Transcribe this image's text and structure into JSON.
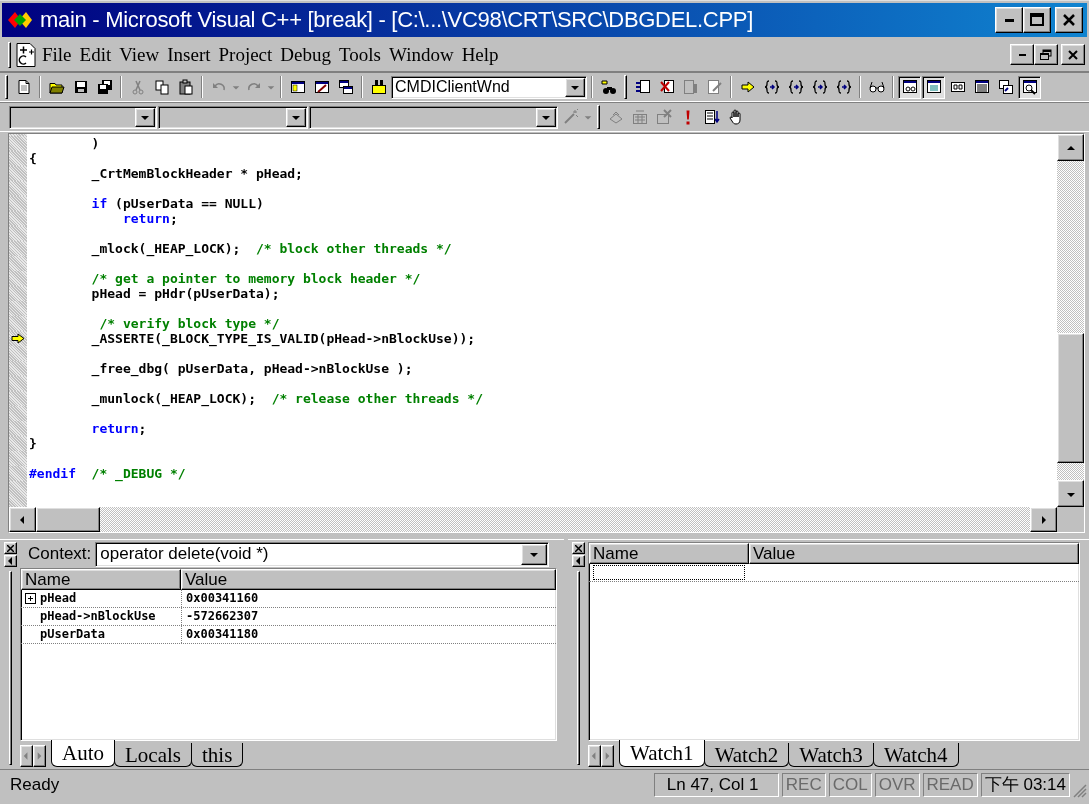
{
  "window": {
    "title": "main - Microsoft Visual C++ [break] - [C:\\...\\VC98\\CRT\\SRC\\DBGDEL.CPP]"
  },
  "menu": [
    {
      "label": "File"
    },
    {
      "label": "Edit"
    },
    {
      "label": "View"
    },
    {
      "label": "Insert"
    },
    {
      "label": "Project"
    },
    {
      "label": "Debug"
    },
    {
      "label": "Tools"
    },
    {
      "label": "Window"
    },
    {
      "label": "Help"
    }
  ],
  "toolbar": {
    "combo_value": "CMDIClientWnd",
    "debug_window_buttons": [
      {
        "pressed": true
      },
      {
        "pressed": true
      },
      {
        "pressed": false
      },
      {
        "pressed": false
      },
      {
        "pressed": false
      },
      {
        "pressed": true
      }
    ]
  },
  "editor": {
    "lines": [
      {
        "blank_before": false,
        "current": false,
        "tokens": [
          {
            "text": "        )",
            "kind": "code"
          }
        ]
      },
      {
        "blank_before": false,
        "current": false,
        "tokens": [
          {
            "text": "{",
            "kind": "code"
          }
        ]
      },
      {
        "blank_before": false,
        "current": false,
        "tokens": [
          {
            "text": "        _CrtMemBlockHeader * pHead;",
            "kind": "code"
          }
        ]
      },
      {
        "blank_before": true,
        "current": false,
        "tokens": [
          {
            "text": "        if",
            "kind": "keyword"
          },
          {
            "text": " (pUserData == NULL)",
            "kind": "code"
          }
        ]
      },
      {
        "blank_before": false,
        "current": false,
        "tokens": [
          {
            "text": "            return",
            "kind": "keyword"
          },
          {
            "text": ";",
            "kind": "code"
          }
        ]
      },
      {
        "blank_before": true,
        "current": false,
        "tokens": [
          {
            "text": "        _mlock(_HEAP_LOCK);  ",
            "kind": "code"
          },
          {
            "text": "/* block other threads */",
            "kind": "comment"
          }
        ]
      },
      {
        "blank_before": true,
        "current": false,
        "tokens": [
          {
            "text": "        /* get a pointer to memory block header */",
            "kind": "comment"
          }
        ]
      },
      {
        "blank_before": false,
        "current": false,
        "tokens": [
          {
            "text": "        pHead = pHdr(pUserData);",
            "kind": "code"
          }
        ]
      },
      {
        "blank_before": true,
        "current": false,
        "tokens": [
          {
            "text": "         /* verify block type */",
            "kind": "comment"
          }
        ]
      },
      {
        "blank_before": false,
        "current": true,
        "tokens": [
          {
            "text": "        _ASSERTE(_BLOCK_TYPE_IS_VALID(pHead->nBlockUse));",
            "kind": "code"
          }
        ]
      },
      {
        "blank_before": true,
        "current": false,
        "tokens": [
          {
            "text": "        _free_dbg( pUserData, pHead->nBlockUse );",
            "kind": "code"
          }
        ]
      },
      {
        "blank_before": true,
        "current": false,
        "tokens": [
          {
            "text": "        _munlock(_HEAP_LOCK);  ",
            "kind": "code"
          },
          {
            "text": "/* release other threads */",
            "kind": "comment"
          }
        ]
      },
      {
        "blank_before": true,
        "current": false,
        "tokens": [
          {
            "text": "        return",
            "kind": "keyword"
          },
          {
            "text": ";",
            "kind": "code"
          }
        ]
      },
      {
        "blank_before": false,
        "current": false,
        "tokens": [
          {
            "text": "}",
            "kind": "code"
          }
        ]
      },
      {
        "blank_before": true,
        "current": false,
        "tokens": [
          {
            "text": "#endif",
            "kind": "keyword"
          },
          {
            "text": "  /* _DEBUG */",
            "kind": "comment"
          }
        ]
      }
    ]
  },
  "variables": {
    "context_label": "Context:",
    "context_value": "operator delete(void *)",
    "columns": [
      "Name",
      "Value"
    ],
    "rows": [
      {
        "name": "pHead",
        "value": "0x00341160",
        "expandable": true
      },
      {
        "name": "pHead->nBlockUse",
        "value": "-572662307",
        "expandable": false
      },
      {
        "name": "pUserData",
        "value": "0x00341180",
        "expandable": false
      }
    ],
    "tabs": [
      {
        "label": "Auto",
        "selected": true
      },
      {
        "label": "Locals",
        "selected": false
      },
      {
        "label": "this",
        "selected": false
      }
    ]
  },
  "watch": {
    "columns": [
      "Name",
      "Value"
    ],
    "tabs": [
      {
        "label": "Watch1",
        "selected": true
      },
      {
        "label": "Watch2",
        "selected": false
      },
      {
        "label": "Watch3",
        "selected": false
      },
      {
        "label": "Watch4",
        "selected": false
      }
    ]
  },
  "status_bar": {
    "message": "Ready",
    "position": "Ln 47, Col 1",
    "indicators": [
      {
        "label": "REC",
        "disabled": true
      },
      {
        "label": "COL",
        "disabled": true
      },
      {
        "label": "OVR",
        "disabled": true
      },
      {
        "label": "READ",
        "disabled": true
      }
    ],
    "time": "下午 03:14"
  }
}
